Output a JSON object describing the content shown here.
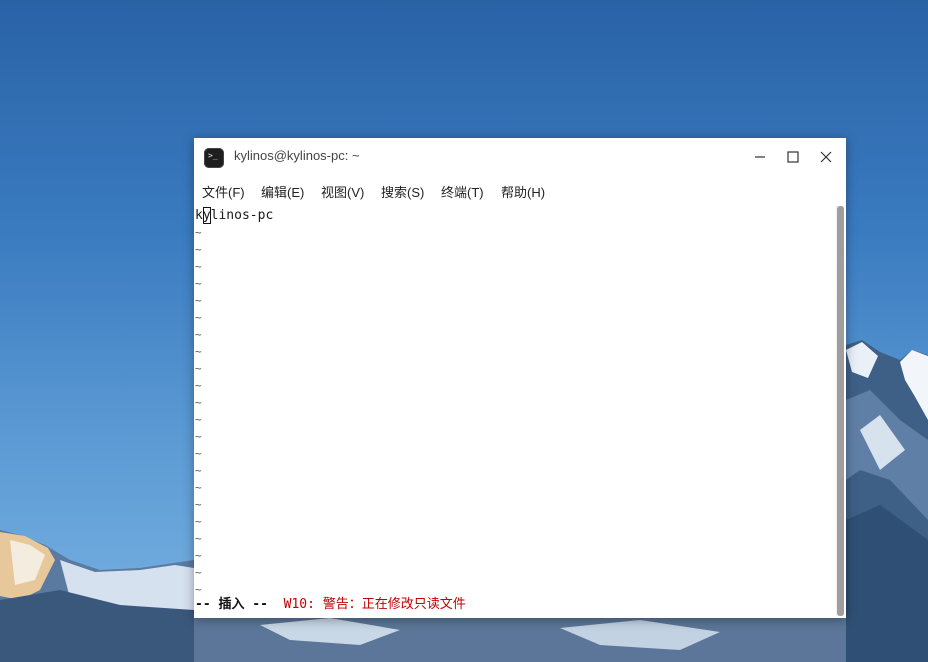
{
  "window": {
    "title": "kylinos@kylinos-pc: ~"
  },
  "menu": {
    "file": "文件(F)",
    "edit": "编辑(E)",
    "view": "视图(V)",
    "search": "搜索(S)",
    "terminal": "终端(T)",
    "help": "帮助(H)"
  },
  "editor": {
    "before_cursor": "k",
    "cursor_char": "y",
    "after_cursor": "linos-pc",
    "empty_line_marker": "~",
    "empty_line_count": 22,
    "status_mode": "-- 插入 --",
    "status_warning": "W10: 警告：正在修改只读文件"
  },
  "icons": {
    "app": "terminal-icon",
    "minimize": "minimize-icon",
    "maximize": "maximize-icon",
    "close": "close-icon"
  },
  "colors": {
    "warning": "#c00000"
  }
}
